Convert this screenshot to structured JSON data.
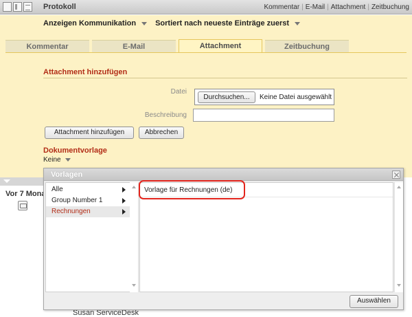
{
  "header": {
    "title": "Protokoll",
    "links": [
      "Kommentar",
      "E-Mail",
      "Attachment",
      "Zeitbuchung"
    ]
  },
  "filters": {
    "show_label": "Anzeigen Kommunikation",
    "sort_label": "Sortiert nach neueste Einträge zuerst"
  },
  "tabs": [
    {
      "label": "Kommentar",
      "active": false
    },
    {
      "label": "E-Mail",
      "active": false
    },
    {
      "label": "Attachment",
      "active": true
    },
    {
      "label": "Zeitbuchung",
      "active": false
    }
  ],
  "attachment": {
    "section_title": "Attachment hinzufügen",
    "file_label": "Datei",
    "browse_button": "Durchsuchen...",
    "no_file_text": "Keine Datei ausgewählt",
    "description_label": "Beschreibung",
    "description_value": "",
    "add_button": "Attachment hinzufügen",
    "cancel_button": "Abbrechen"
  },
  "document_template": {
    "section_title": "Dokumentvorlage",
    "selected": "Keine"
  },
  "sidebar": {
    "vor_text": "Vor 7 Mona"
  },
  "dialog": {
    "title": "Vorlagen",
    "categories": [
      {
        "label": "Alle",
        "selected": false
      },
      {
        "label": "Group Number 1",
        "selected": false
      },
      {
        "label": "Rechnungen",
        "selected": true
      }
    ],
    "templates": [
      "Vorlage für Rechnungen (de)"
    ],
    "select_button": "Auswählen"
  },
  "behind_text": "Susan ServiceDesk",
  "colors": {
    "accent_red": "#b22d17",
    "yellow_bg": "#fdf2c5",
    "highlight_red": "#e3241c"
  }
}
